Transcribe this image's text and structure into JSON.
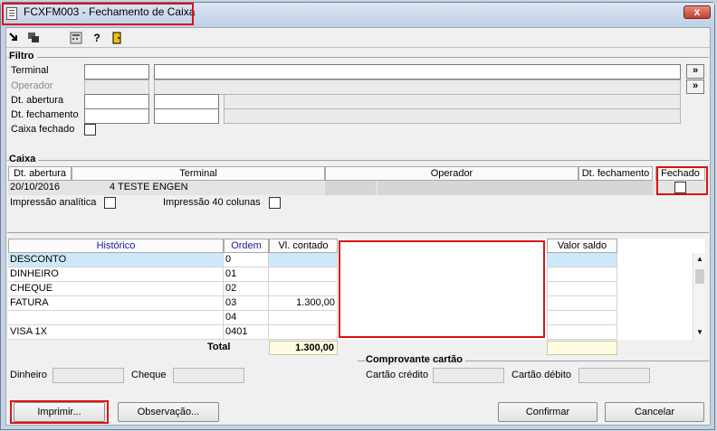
{
  "window": {
    "title": "FCXFM003 - Fechamento de Caixa",
    "close_label": "x"
  },
  "toolbar": {
    "icons": [
      "exit-icon",
      "windows-icon",
      "calculator-icon",
      "help-icon",
      "door-exit-icon"
    ]
  },
  "filtro": {
    "legend": "Filtro",
    "terminal_label": "Terminal",
    "operador_label": "Operador",
    "dt_abertura_label": "Dt. abertura",
    "dt_fechamento_label": "Dt. fechamento",
    "caixa_fechado_label": "Caixa fechado",
    "nav_button_label": "»"
  },
  "caixa": {
    "legend": "Caixa",
    "columns": [
      "Dt. abertura",
      "Terminal",
      "Operador",
      "Dt. fechamento",
      "Fechado"
    ],
    "row": {
      "dt_abertura": "20/10/2016",
      "terminal_num": "4",
      "terminal_name": "TESTE ENGEN"
    },
    "impressao_analitica_label": "Impressão analítica",
    "impressao_40_label": "Impressão 40 colunas"
  },
  "grid": {
    "columns": {
      "historico": "Histórico",
      "ordem": "Ordem",
      "vl_contado": "Vl. contado",
      "valor_saldo": "Valor saldo"
    },
    "rows": [
      {
        "historico": "DESCONTO",
        "ordem": "0",
        "vl_contado": ""
      },
      {
        "historico": "DINHEIRO",
        "ordem": "01",
        "vl_contado": ""
      },
      {
        "historico": "CHEQUE",
        "ordem": "02",
        "vl_contado": ""
      },
      {
        "historico": "FATURA",
        "ordem": "03",
        "vl_contado": "1.300,00"
      },
      {
        "historico": "",
        "ordem": "04",
        "vl_contado": ""
      },
      {
        "historico": "VISA 1X",
        "ordem": "0401",
        "vl_contado": ""
      }
    ],
    "total_label": "Total",
    "total_value": "1.300,00"
  },
  "bottom": {
    "dinheiro_label": "Dinheiro",
    "cheque_label": "Cheque",
    "comprovante_legend": "Comprovante cartão",
    "cartao_credito_label": "Cartão crédito",
    "cartao_debito_label": "Cartão débito"
  },
  "buttons": {
    "imprimir": "Imprimir...",
    "observacao": "Observação...",
    "confirmar": "Confirmar",
    "cancelar": "Cancelar"
  },
  "colors": {
    "highlight_red": "#dd1111",
    "selected_cell": "#cde8f9",
    "total_bg": "#fffbe0",
    "header_blue": "#1a1a9a"
  }
}
